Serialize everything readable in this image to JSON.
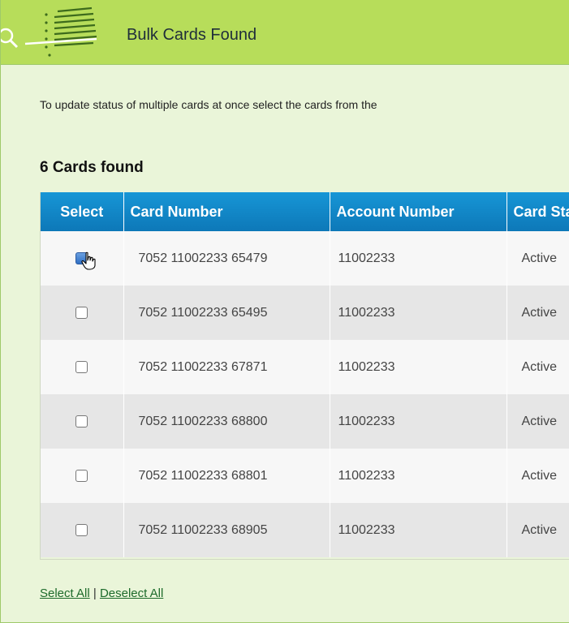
{
  "header": {
    "title": "Bulk Cards Found",
    "icon": "search-list-icon"
  },
  "intro_text": "To update status of multiple cards at once select the cards from the",
  "found_count_text": "6 Cards found",
  "table": {
    "columns": [
      "Select",
      "Card Number",
      "Account Number",
      "Card Status"
    ],
    "rows": [
      {
        "checked": true,
        "card_number": "7052 11002233 65479",
        "account_number": "11002233",
        "status": "Active"
      },
      {
        "checked": false,
        "card_number": "7052 11002233 65495",
        "account_number": "11002233",
        "status": "Active"
      },
      {
        "checked": false,
        "card_number": "7052 11002233 67871",
        "account_number": "11002233",
        "status": "Active"
      },
      {
        "checked": false,
        "card_number": "7052 11002233 68800",
        "account_number": "11002233",
        "status": "Active"
      },
      {
        "checked": false,
        "card_number": "7052 11002233 68801",
        "account_number": "11002233",
        "status": "Active"
      },
      {
        "checked": false,
        "card_number": "7052 11002233 68905",
        "account_number": "11002233",
        "status": "Active"
      }
    ]
  },
  "links": {
    "select_all": "Select All",
    "separator": "|",
    "deselect_all": "Deselect All"
  },
  "colors": {
    "header_bg": "#b7dd5a",
    "panel_bg": "#eaf5d9",
    "table_header_bg": "#1183c6",
    "link": "#1d6b2b"
  }
}
